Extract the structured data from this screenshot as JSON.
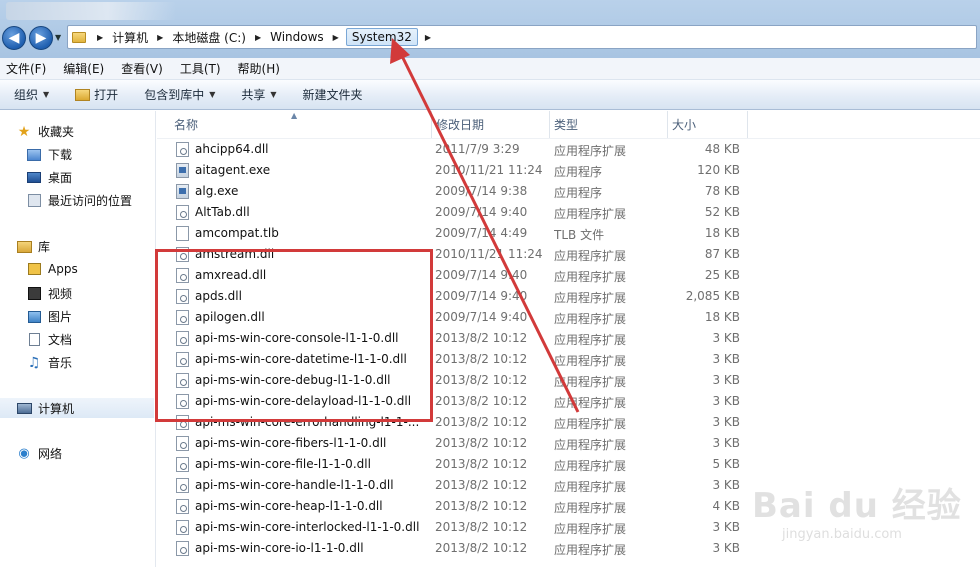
{
  "window": {
    "title": ""
  },
  "address": {
    "crumbs": [
      "计算机",
      "本地磁盘 (C:)",
      "Windows",
      "System32"
    ]
  },
  "menu": [
    "文件(F)",
    "编辑(E)",
    "查看(V)",
    "工具(T)",
    "帮助(H)"
  ],
  "toolbar": {
    "organize": "组织",
    "open": "打开",
    "include_library": "包含到库中",
    "share": "共享",
    "new_folder": "新建文件夹"
  },
  "nav": {
    "favorites": "收藏夹",
    "downloads": "下载",
    "desktop": "桌面",
    "recent": "最近访问的位置",
    "libraries": "库",
    "apps": "Apps",
    "videos": "视频",
    "pictures": "图片",
    "documents": "文档",
    "music": "音乐",
    "computer": "计算机",
    "network": "网络"
  },
  "columns": {
    "name": "名称",
    "date": "修改日期",
    "type": "类型",
    "size": "大小"
  },
  "files": [
    {
      "name": "ahcipp64.dll",
      "date": "2011/7/9 3:29",
      "type": "应用程序扩展",
      "size": "48 KB",
      "kind": "dll"
    },
    {
      "name": "aitagent.exe",
      "date": "2010/11/21 11:24",
      "type": "应用程序",
      "size": "120 KB",
      "kind": "exe"
    },
    {
      "name": "alg.exe",
      "date": "2009/7/14 9:38",
      "type": "应用程序",
      "size": "78 KB",
      "kind": "exe"
    },
    {
      "name": "AltTab.dll",
      "date": "2009/7/14 9:40",
      "type": "应用程序扩展",
      "size": "52 KB",
      "kind": "dll"
    },
    {
      "name": "amcompat.tlb",
      "date": "2009/7/14 4:49",
      "type": "TLB 文件",
      "size": "18 KB",
      "kind": "file"
    },
    {
      "name": "amstream.dll",
      "date": "2010/11/21 11:24",
      "type": "应用程序扩展",
      "size": "87 KB",
      "kind": "dll"
    },
    {
      "name": "amxread.dll",
      "date": "2009/7/14 9:40",
      "type": "应用程序扩展",
      "size": "25 KB",
      "kind": "dll"
    },
    {
      "name": "apds.dll",
      "date": "2009/7/14 9:40",
      "type": "应用程序扩展",
      "size": "2,085 KB",
      "kind": "dll"
    },
    {
      "name": "apilogen.dll",
      "date": "2009/7/14 9:40",
      "type": "应用程序扩展",
      "size": "18 KB",
      "kind": "dll"
    },
    {
      "name": "api-ms-win-core-console-l1-1-0.dll",
      "date": "2013/8/2 10:12",
      "type": "应用程序扩展",
      "size": "3 KB",
      "kind": "dll"
    },
    {
      "name": "api-ms-win-core-datetime-l1-1-0.dll",
      "date": "2013/8/2 10:12",
      "type": "应用程序扩展",
      "size": "3 KB",
      "kind": "dll"
    },
    {
      "name": "api-ms-win-core-debug-l1-1-0.dll",
      "date": "2013/8/2 10:12",
      "type": "应用程序扩展",
      "size": "3 KB",
      "kind": "dll"
    },
    {
      "name": "api-ms-win-core-delayload-l1-1-0.dll",
      "date": "2013/8/2 10:12",
      "type": "应用程序扩展",
      "size": "3 KB",
      "kind": "dll"
    },
    {
      "name": "api-ms-win-core-errorhandling-l1-1-...",
      "date": "2013/8/2 10:12",
      "type": "应用程序扩展",
      "size": "3 KB",
      "kind": "dll"
    },
    {
      "name": "api-ms-win-core-fibers-l1-1-0.dll",
      "date": "2013/8/2 10:12",
      "type": "应用程序扩展",
      "size": "3 KB",
      "kind": "dll"
    },
    {
      "name": "api-ms-win-core-file-l1-1-0.dll",
      "date": "2013/8/2 10:12",
      "type": "应用程序扩展",
      "size": "5 KB",
      "kind": "dll"
    },
    {
      "name": "api-ms-win-core-handle-l1-1-0.dll",
      "date": "2013/8/2 10:12",
      "type": "应用程序扩展",
      "size": "3 KB",
      "kind": "dll"
    },
    {
      "name": "api-ms-win-core-heap-l1-1-0.dll",
      "date": "2013/8/2 10:12",
      "type": "应用程序扩展",
      "size": "4 KB",
      "kind": "dll"
    },
    {
      "name": "api-ms-win-core-interlocked-l1-1-0.dll",
      "date": "2013/8/2 10:12",
      "type": "应用程序扩展",
      "size": "3 KB",
      "kind": "dll"
    },
    {
      "name": "api-ms-win-core-io-l1-1-0.dll",
      "date": "2013/8/2 10:12",
      "type": "应用程序扩展",
      "size": "3 KB",
      "kind": "dll"
    }
  ],
  "watermark": {
    "logo": "Bai du 经验",
    "sub": "jingyan.baidu.com"
  },
  "colors": {
    "annotation": "#d23a3a",
    "address_bar": "#b9d1ea",
    "toolbar": "#dfe9f5"
  }
}
